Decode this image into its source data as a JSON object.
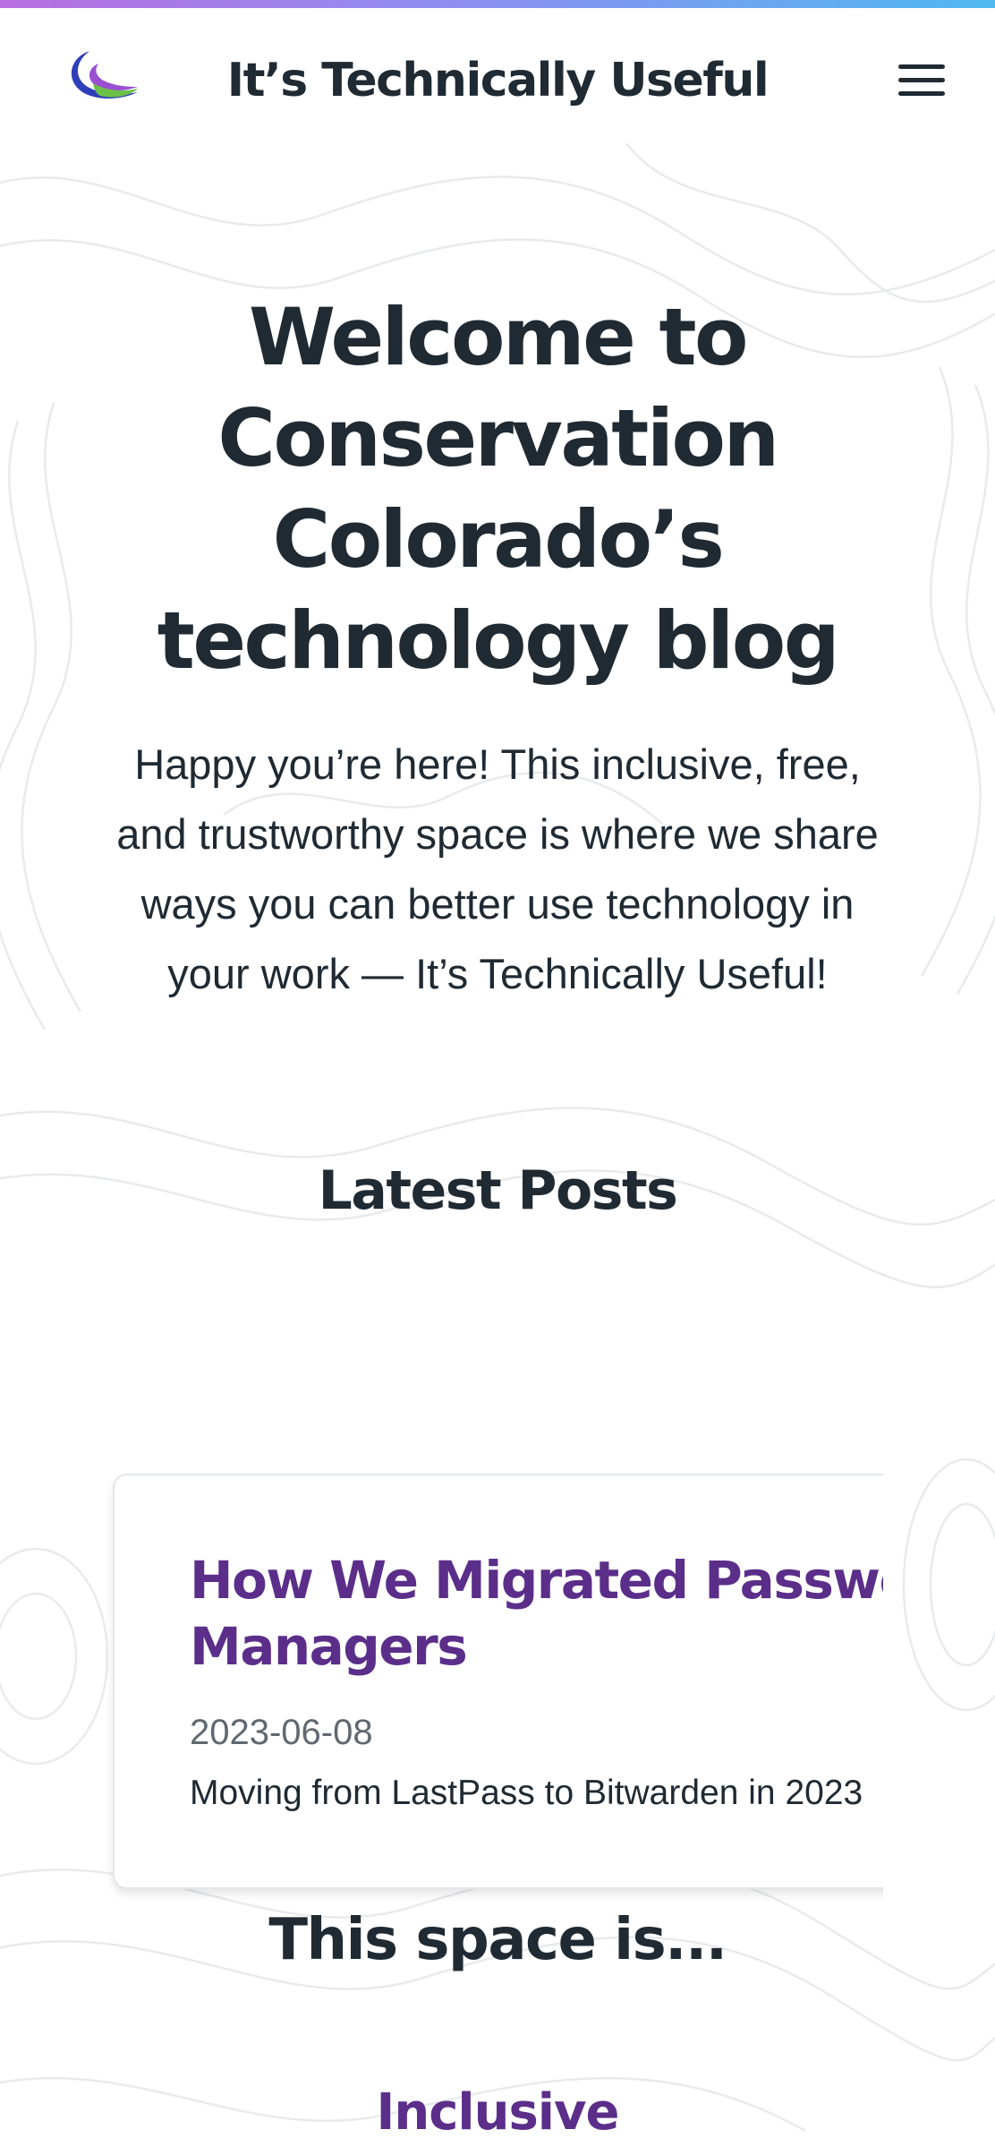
{
  "header": {
    "site_title": "It’s Technically Useful",
    "logo_icon": "swoosh-logo-icon",
    "menu_icon": "hamburger-menu-icon"
  },
  "hero": {
    "title": "Welcome to Conservation Colorado’s technology blog",
    "intro": "Happy you’re here! This inclusive, free, and trustworthy space is where we share ways you can better use technology in your work — It’s Technically Useful!"
  },
  "latest_posts": {
    "heading": "Latest Posts",
    "posts": [
      {
        "title": "How We Migrated Password Managers",
        "date": "2023-06-08",
        "summary": "Moving from LastPass to Bitwarden in 2023"
      }
    ]
  },
  "values": {
    "heading": "This space is...",
    "items": [
      "Inclusive"
    ]
  },
  "colors": {
    "accent_purple": "#5b2e8a",
    "text_dark": "#1f2a33",
    "date_gray": "#606870",
    "top_bar_start": "#b86ee0",
    "top_bar_end": "#4fb8ef"
  }
}
